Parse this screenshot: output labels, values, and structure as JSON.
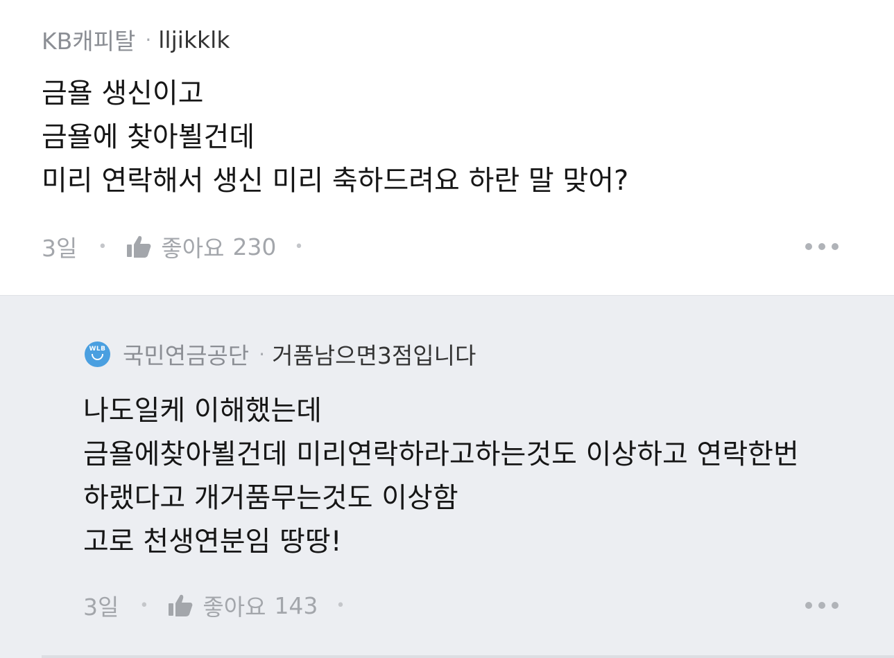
{
  "comments": [
    {
      "company": "KB캐피탈",
      "separator": "·",
      "nickname": "lljikklk",
      "lines": [
        "금욜 생신이고",
        "금욜에 찾아뵐건데",
        "미리 연락해서 생신 미리 축하드려요 하란 말 맞어?"
      ],
      "time": "3일",
      "like_label": "좋아요",
      "like_count": "230"
    }
  ],
  "replies": [
    {
      "avatar_text": "WLB",
      "company": "국민연금공단",
      "separator": "·",
      "nickname": "거품남으면3점입니다",
      "lines": [
        "나도일케 이해했는데",
        "금욜에찾아뵐건데 미리연락하라고하는것도 이상하고 연락한번",
        "하랬다고 개거품무는것도 이상함",
        "고로 천생연분임 땅땅!"
      ],
      "time": "3일",
      "like_label": "좋아요",
      "like_count": "143"
    }
  ],
  "icons": {
    "thumb": "thumbs-up-icon",
    "more": "more-options-icon",
    "avatar": "company-avatar-icon"
  },
  "colors": {
    "reply_background": "#eceef2",
    "avatar_blue": "#4a9fe0",
    "meta_gray": "#a3a6ab"
  }
}
